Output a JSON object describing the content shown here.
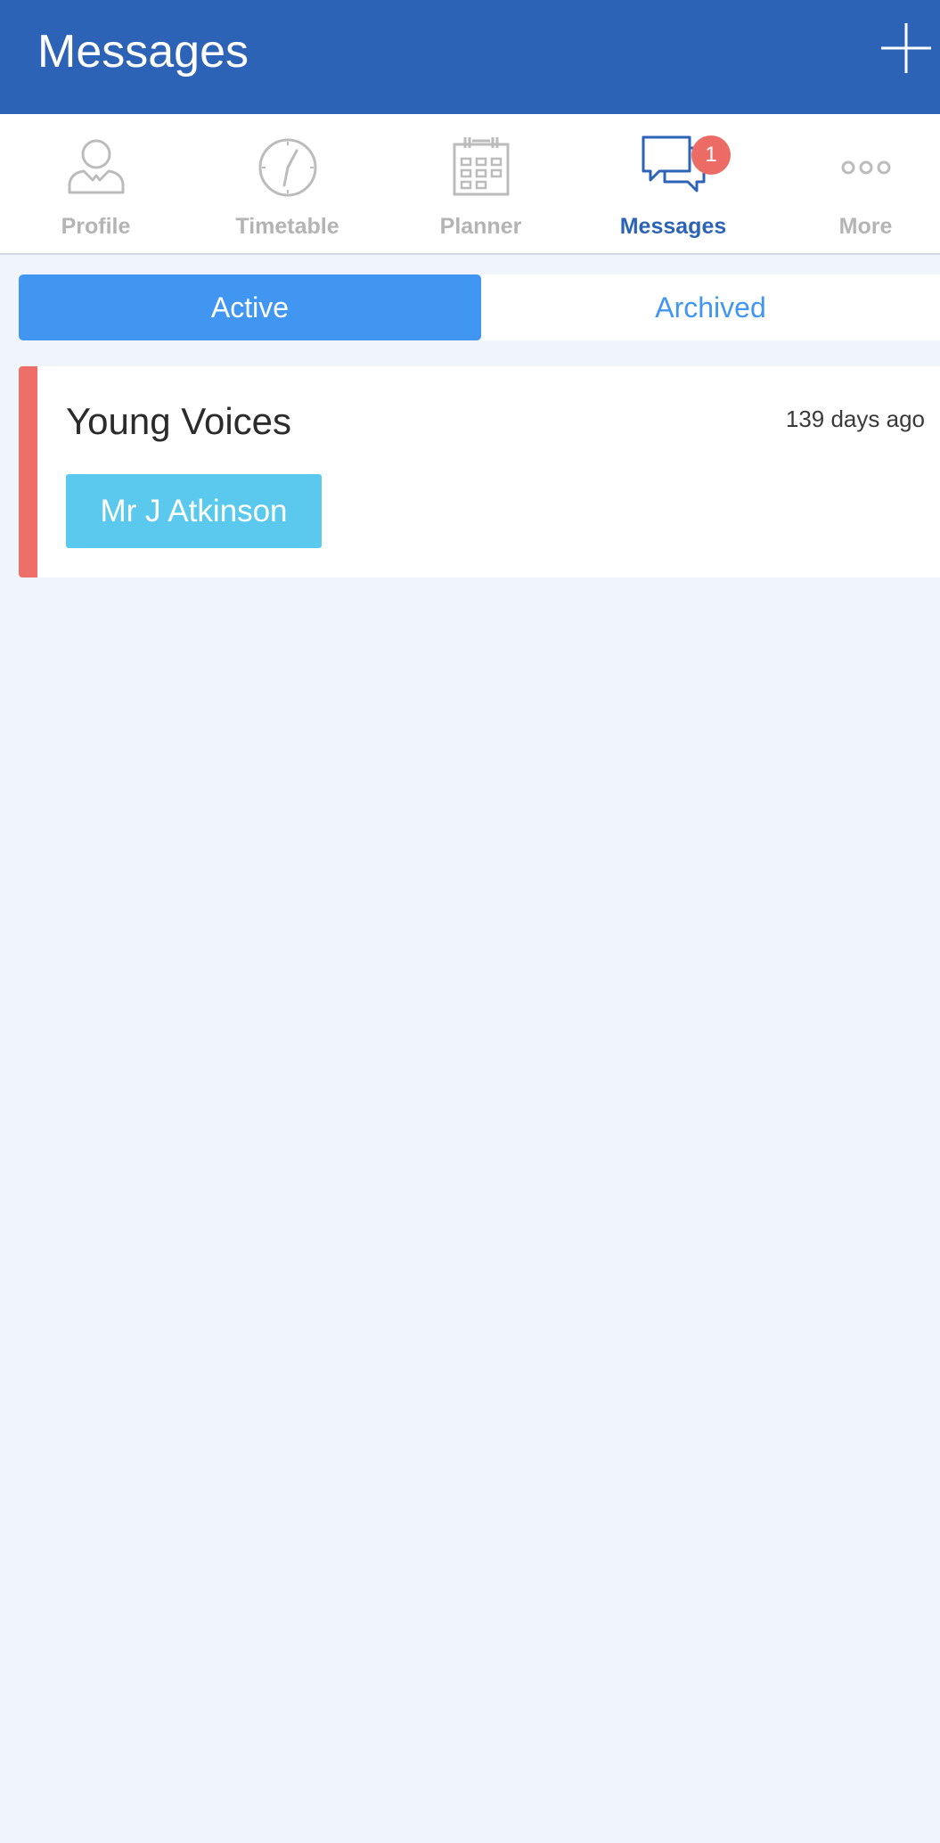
{
  "header": {
    "title": "Messages",
    "add_icon": "plus-icon"
  },
  "nav": {
    "items": [
      {
        "label": "Profile",
        "icon": "person-icon",
        "active": false
      },
      {
        "label": "Timetable",
        "icon": "clock-icon",
        "active": false
      },
      {
        "label": "Planner",
        "icon": "calendar-icon",
        "active": false
      },
      {
        "label": "Messages",
        "icon": "chat-bubbles-icon",
        "active": true,
        "badge": "1"
      },
      {
        "label": "More",
        "icon": "more-dots-icon",
        "active": false
      }
    ]
  },
  "segments": {
    "active_label": "Active",
    "archived_label": "Archived",
    "selected": "Active"
  },
  "messages": [
    {
      "title": "Young Voices",
      "time": "139 days ago",
      "sender": "Mr J Atkinson"
    }
  ],
  "colors": {
    "header_bg": "#2d63b7",
    "accent": "#4196f2",
    "badge": "#ed6b65",
    "stripe": "#ee6f69",
    "sender_tag": "#5ac9ed",
    "inactive_nav": "#b4b4b4",
    "page_bg": "#f0f5fc"
  }
}
